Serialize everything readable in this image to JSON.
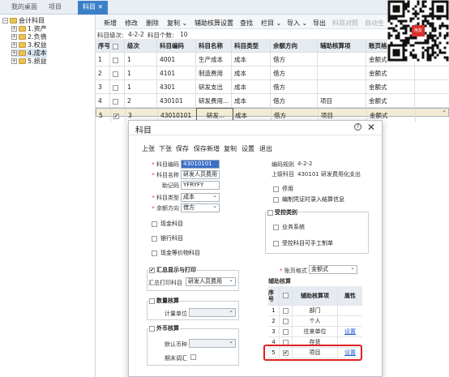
{
  "tabs": [
    {
      "label": "我的桌面"
    },
    {
      "label": "项目"
    },
    {
      "label": "科目"
    }
  ],
  "tree": {
    "root": "会计科目",
    "items": [
      "1.资产",
      "2.负债",
      "3.权益",
      "4.成本",
      "5.损益"
    ]
  },
  "toolbar": {
    "items": [
      "新增",
      "修改",
      "删除",
      "复制 ⌄",
      "辅助核算设置",
      "查找",
      "栏目 ⌄",
      "导入 ⌄",
      "导出",
      "科目对照",
      "自动生"
    ]
  },
  "subbar": {
    "level_label": "科目级次:",
    "level_value": "4-2-2",
    "count_label": "科目个数:",
    "count_value": "10"
  },
  "grid": {
    "headers": [
      "序号",
      "",
      "级次",
      "科目编码",
      "科目名称",
      "科目类型",
      "余额方向",
      "辅助核算项",
      "账页格"
    ],
    "rows": [
      [
        "1",
        "",
        "1",
        "4001",
        "生产成本",
        "成本",
        "借方",
        "",
        "金额式"
      ],
      [
        "2",
        "",
        "1",
        "4101",
        "制造费用",
        "成本",
        "借方",
        "",
        "金额式"
      ],
      [
        "3",
        "",
        "1",
        "4301",
        "研发支出",
        "成本",
        "借方",
        "",
        "金额式"
      ],
      [
        "4",
        "",
        "2",
        "430101",
        "研发费用...",
        "成本",
        "借方",
        "项目",
        "金额式"
      ],
      [
        "5",
        "✔",
        "3",
        "43010101",
        "研发...",
        "成本",
        "借方",
        "项目",
        "金额式"
      ]
    ]
  },
  "dialog": {
    "title": "科目",
    "help_icon": "?",
    "close_icon": "✕",
    "actions": [
      "上张",
      "下张",
      "保存",
      "保存新增",
      "复制",
      "设置",
      "退出"
    ],
    "fields": {
      "code_label": "科目编码",
      "code_value": "43010101",
      "name_label": "科目名称",
      "name_value": "研发人员费用",
      "mnemonic_label": "助记码",
      "mnemonic_value": "YFRYFY",
      "type_label": "科目类型",
      "type_value": "成本",
      "balance_label": "余额方向",
      "balance_value": "借方"
    },
    "right_info": {
      "rule_label": "编码规则",
      "rule_value": "4-2-2",
      "parent_label": "上级科目",
      "parent_value": "430101 研发费用化支出"
    },
    "checks_left": [
      "现金科目",
      "银行科目",
      "现金等价物科目"
    ],
    "checks_right": [
      "停用",
      "编制凭证时录入结算信息"
    ],
    "controlled": {
      "title": "受控类别",
      "items": [
        "业务系统",
        "受控科目可手工制单"
      ]
    },
    "summary": {
      "title": "汇总显示与打印",
      "label": "汇总打印科目",
      "value": "研发人员费用"
    },
    "quantity": {
      "title": "数量核算",
      "label": "计量单位",
      "value": ""
    },
    "currency": {
      "title": "外币核算",
      "label": "默认币种",
      "value": "",
      "period_end_label": "期末调汇"
    },
    "ledger": {
      "label": "账页格式",
      "value": "金额式"
    },
    "aux": {
      "title": "辅助核算",
      "headers": [
        "序号",
        "",
        "辅助核算项",
        "属性"
      ],
      "rows": [
        {
          "no": "1",
          "checked": "",
          "name": "部门",
          "attr": ""
        },
        {
          "no": "2",
          "checked": "",
          "name": "个人",
          "attr": ""
        },
        {
          "no": "3",
          "checked": "",
          "name": "往来单位",
          "attr": "设置"
        },
        {
          "no": "4",
          "checked": "",
          "name": "存货",
          "attr": ""
        },
        {
          "no": "5",
          "checked": "✔",
          "name": "项目",
          "attr": "设置"
        }
      ]
    }
  },
  "qr_badge": "用友",
  "colors": {
    "accent": "#3c7fc9",
    "selected_row": "#f3ecd3",
    "highlight_border": "#e02020",
    "link": "#1f5bd3"
  }
}
